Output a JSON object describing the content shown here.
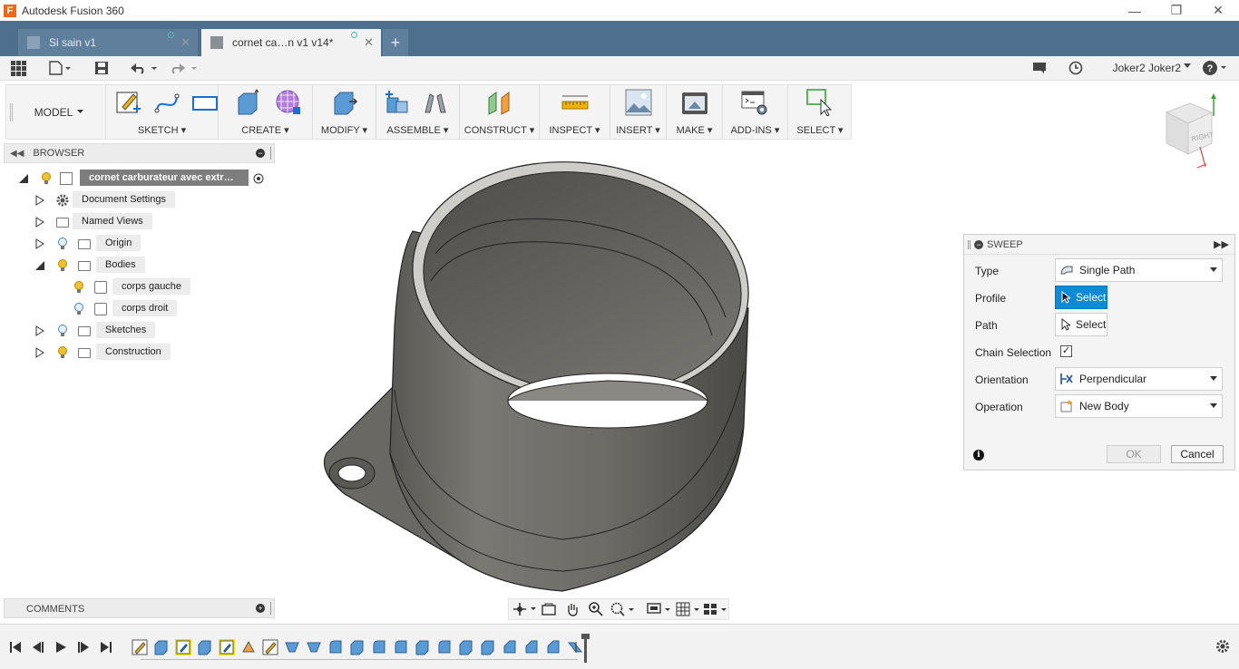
{
  "window": {
    "title": "Autodesk Fusion 360",
    "logo_letter": "F"
  },
  "tabs": [
    {
      "label": "Si sain v1"
    },
    {
      "label": "cornet ca…n v1 v14*"
    }
  ],
  "quickbar": {
    "user": "Joker2 Joker2"
  },
  "toolbar": {
    "workspace": "MODEL",
    "groups": [
      {
        "label": "SKETCH ▾"
      },
      {
        "label": "CREATE ▾"
      },
      {
        "label": "MODIFY ▾"
      },
      {
        "label": "ASSEMBLE ▾"
      },
      {
        "label": "CONSTRUCT ▾"
      },
      {
        "label": "INSPECT ▾"
      },
      {
        "label": "INSERT ▾"
      },
      {
        "label": "MAKE ▾"
      },
      {
        "label": "ADD-INS ▾"
      },
      {
        "label": "SELECT ▾"
      }
    ]
  },
  "browser": {
    "title": "BROWSER",
    "root": "cornet carburateur avec extr…",
    "items": [
      {
        "label": "Document Settings"
      },
      {
        "label": "Named Views"
      },
      {
        "label": "Origin"
      },
      {
        "label": "Bodies"
      },
      {
        "label": "corps gauche"
      },
      {
        "label": "corps droit"
      },
      {
        "label": "Sketches"
      },
      {
        "label": "Construction"
      }
    ]
  },
  "comments": {
    "title": "COMMENTS"
  },
  "viewcube": {
    "face": "RIGHT"
  },
  "sweep": {
    "title": "SWEEP",
    "type_label": "Type",
    "type_value": "Single Path",
    "profile_label": "Profile",
    "profile_btn": "Select",
    "path_label": "Path",
    "path_btn": "Select",
    "chain_label": "Chain Selection",
    "chain_checked": "✓",
    "orientation_label": "Orientation",
    "orientation_value": "Perpendicular",
    "operation_label": "Operation",
    "operation_value": "New Body",
    "ok": "OK",
    "cancel": "Cancel"
  },
  "colors": {
    "tabbar": "#4f6f8e",
    "accent": "#0f8ad6",
    "model": "#6e6c68"
  }
}
